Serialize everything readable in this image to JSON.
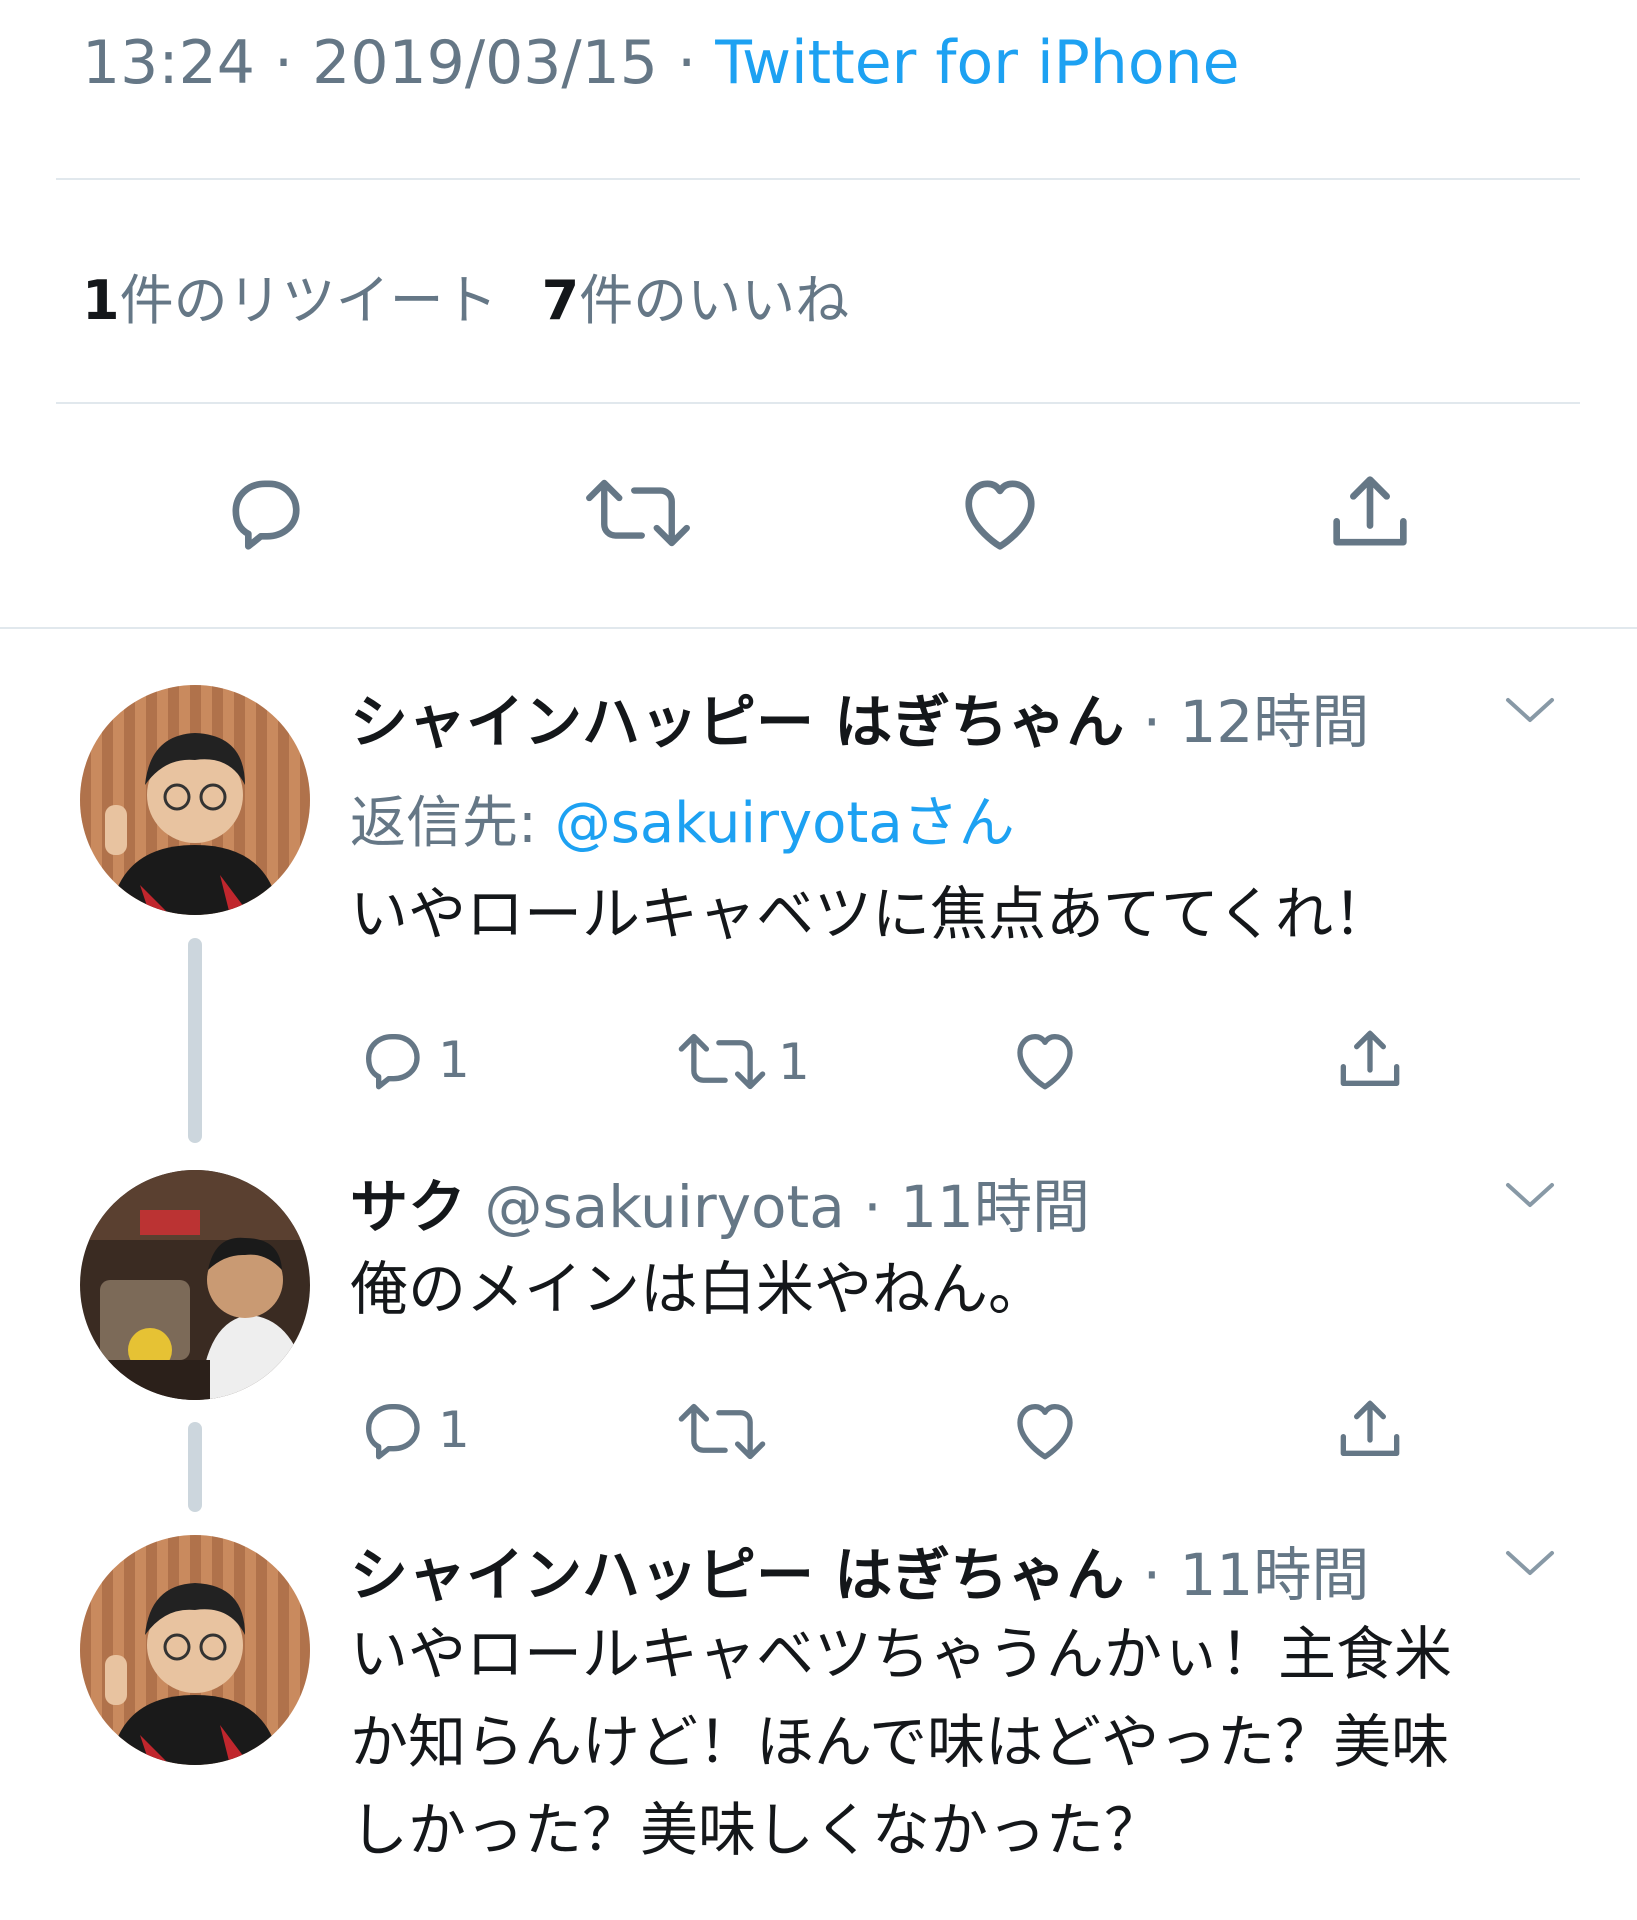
{
  "detail": {
    "time": "13:24",
    "date": "2019/03/15",
    "source": "Twitter for iPhone",
    "retweet_count": "1",
    "retweet_label": "件のリツイート",
    "like_count": "7",
    "like_label": "件のいいね"
  },
  "replies": [
    {
      "name": "シャインハッピー はぎちゃん",
      "time": "12時間",
      "reply_prefix": "返信先:",
      "reply_to": "@sakuiryotaさん",
      "text": "いやロールキャベツに焦点あててくれ！",
      "reply_count": "1",
      "retweet_count": "1"
    },
    {
      "name": "サク",
      "handle": "@sakuiryota",
      "time": "11時間",
      "text": "俺のメインは白米やねん。",
      "reply_count": "1"
    },
    {
      "name": "シャインハッピー はぎちゃん",
      "time": "11時間",
      "text_lines": [
        "いやロールキャベツちゃうんかぃ！主食米",
        "か知らんけど！ほんで味はどやった？美味",
        "しかった？美味しくなかった？"
      ]
    }
  ],
  "colors": {
    "accent": "#1da1f2",
    "secondary_text": "#657786",
    "divider": "#e1e8ed",
    "thread_line": "#ccd6dd"
  },
  "icons": [
    "reply-icon",
    "retweet-icon",
    "like-icon",
    "share-icon",
    "chevron-down-icon"
  ]
}
